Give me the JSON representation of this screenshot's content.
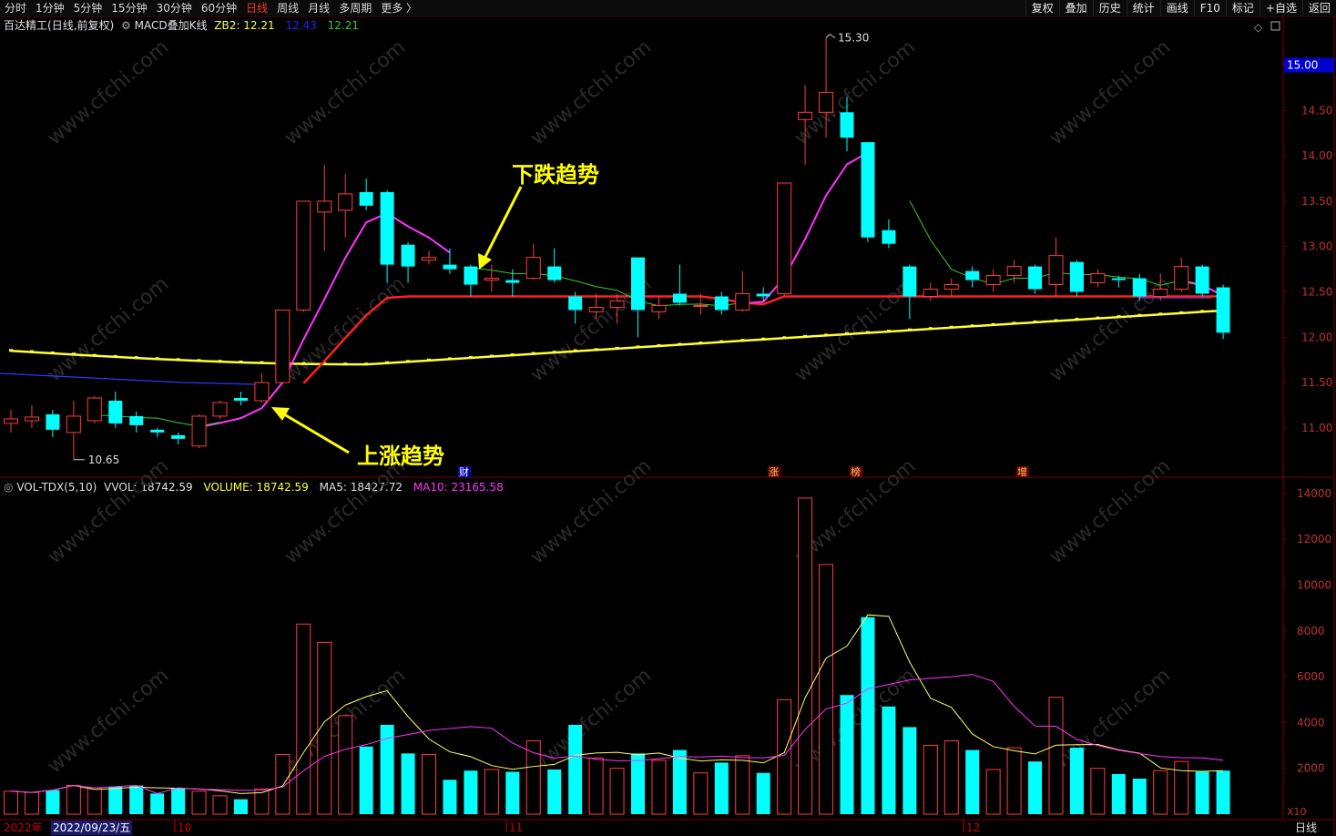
{
  "toolbar": {
    "periods": [
      "分时",
      "1分钟",
      "5分钟",
      "15分钟",
      "30分钟",
      "60分钟",
      "日线",
      "周线",
      "月线",
      "多周期",
      "更多 〉"
    ],
    "active_period": "日线",
    "right_buttons": [
      "复权",
      "叠加",
      "历史",
      "统计",
      "画线",
      "F10",
      "标记",
      "+自选",
      "返回"
    ]
  },
  "main_header": {
    "stock": "百达精工",
    "mode": "(日线,前复权)",
    "indicator": "MACD叠加K线",
    "zb2_label": "ZB2: 12.21",
    "v2": "12.43",
    "v3": "12.21"
  },
  "price_axis": {
    "ticks": [
      "15.00",
      "14.50",
      "14.00",
      "13.50",
      "13.00",
      "12.50",
      "12.00",
      "11.50",
      "11.00"
    ],
    "current": "15.00"
  },
  "annotations": {
    "high": "15.30",
    "low": "10.65",
    "down_trend": "下跌趋势",
    "up_trend": "上涨趋势"
  },
  "event_markers": [
    "财",
    "涨",
    "榜",
    "增"
  ],
  "vol_header": {
    "name": "VOL-TDX(5,10)",
    "vvol": "VVOL: 18742.59",
    "volume": "VOLUME: 18742.59",
    "ma5": "MA5: 18427.72",
    "ma10": "MA10: 23165.58"
  },
  "vol_axis": {
    "ticks": [
      "14000",
      "12000",
      "10000",
      "8000",
      "6000",
      "4000",
      "2000"
    ],
    "unit": "X10"
  },
  "bottom": {
    "year": "2022年",
    "date": "2022/09/23/五",
    "months": [
      "10",
      "11",
      "12"
    ],
    "period": "日线"
  },
  "watermark": "www.cfchi.com",
  "colors": {
    "up": "#ff3c3c",
    "down": "#00ffff",
    "ma_yellow": "#ffff33",
    "ma_red": "#ff2020",
    "ma_magenta": "#ff33ff",
    "ma_green": "#33cc33",
    "ma_blue": "#3333ff"
  },
  "chart_data": {
    "type": "candlestick",
    "candles": [
      {
        "o": 11.05,
        "c": 11.1,
        "h": 11.2,
        "l": 10.95,
        "v": 1000
      },
      {
        "o": 11.08,
        "c": 11.12,
        "h": 11.25,
        "l": 11.0,
        "v": 950
      },
      {
        "o": 11.15,
        "c": 10.98,
        "h": 11.2,
        "l": 10.9,
        "v": 1050
      },
      {
        "o": 10.95,
        "c": 11.13,
        "h": 11.3,
        "l": 10.65,
        "v": 1250
      },
      {
        "o": 11.08,
        "c": 11.33,
        "h": 11.35,
        "l": 11.05,
        "v": 1150
      },
      {
        "o": 11.3,
        "c": 11.05,
        "h": 11.4,
        "l": 11.0,
        "v": 1200
      },
      {
        "o": 11.13,
        "c": 11.03,
        "h": 11.18,
        "l": 10.95,
        "v": 1250
      },
      {
        "o": 10.98,
        "c": 10.95,
        "h": 11.0,
        "l": 10.9,
        "v": 900
      },
      {
        "o": 10.92,
        "c": 10.88,
        "h": 10.95,
        "l": 10.82,
        "v": 1150
      },
      {
        "o": 10.8,
        "c": 11.13,
        "h": 11.15,
        "l": 10.78,
        "v": 1000
      },
      {
        "o": 11.13,
        "c": 11.28,
        "h": 11.3,
        "l": 11.1,
        "v": 800
      },
      {
        "o": 11.33,
        "c": 11.3,
        "h": 11.4,
        "l": 11.25,
        "v": 650
      },
      {
        "o": 11.3,
        "c": 11.5,
        "h": 11.6,
        "l": 11.28,
        "v": 1100
      },
      {
        "o": 11.5,
        "c": 12.3,
        "h": 12.3,
        "l": 11.48,
        "v": 2600
      },
      {
        "o": 12.3,
        "c": 13.5,
        "h": 13.5,
        "l": 12.28,
        "v": 8300
      },
      {
        "o": 13.38,
        "c": 13.5,
        "h": 13.9,
        "l": 12.95,
        "v": 7500
      },
      {
        "o": 13.4,
        "c": 13.58,
        "h": 13.8,
        "l": 13.1,
        "v": 4300
      },
      {
        "o": 13.6,
        "c": 13.45,
        "h": 13.75,
        "l": 13.4,
        "v": 2950
      },
      {
        "o": 13.6,
        "c": 12.8,
        "h": 13.62,
        "l": 12.6,
        "v": 3900
      },
      {
        "o": 13.02,
        "c": 12.78,
        "h": 13.05,
        "l": 12.6,
        "v": 2650
      },
      {
        "o": 12.85,
        "c": 12.88,
        "h": 12.95,
        "l": 12.8,
        "v": 2600
      },
      {
        "o": 12.8,
        "c": 12.75,
        "h": 12.98,
        "l": 12.7,
        "v": 1500
      },
      {
        "o": 12.78,
        "c": 12.58,
        "h": 12.8,
        "l": 12.45,
        "v": 1900
      },
      {
        "o": 12.63,
        "c": 12.65,
        "h": 12.8,
        "l": 12.5,
        "v": 1950
      },
      {
        "o": 12.63,
        "c": 12.6,
        "h": 12.75,
        "l": 12.45,
        "v": 1850
      },
      {
        "o": 12.65,
        "c": 12.88,
        "h": 13.03,
        "l": 12.63,
        "v": 3200
      },
      {
        "o": 12.78,
        "c": 12.63,
        "h": 12.98,
        "l": 12.6,
        "v": 1950
      },
      {
        "o": 12.45,
        "c": 12.3,
        "h": 12.5,
        "l": 12.15,
        "v": 3900
      },
      {
        "o": 12.28,
        "c": 12.33,
        "h": 12.48,
        "l": 12.2,
        "v": 2450
      },
      {
        "o": 12.33,
        "c": 12.4,
        "h": 12.48,
        "l": 12.15,
        "v": 2000
      },
      {
        "o": 12.88,
        "c": 12.3,
        "h": 12.88,
        "l": 12.0,
        "v": 2650
      },
      {
        "o": 12.28,
        "c": 12.35,
        "h": 12.45,
        "l": 12.2,
        "v": 2350
      },
      {
        "o": 12.48,
        "c": 12.38,
        "h": 12.8,
        "l": 12.35,
        "v": 2800
      },
      {
        "o": 12.35,
        "c": 12.35,
        "h": 12.48,
        "l": 12.25,
        "v": 1800
      },
      {
        "o": 12.45,
        "c": 12.3,
        "h": 12.5,
        "l": 12.25,
        "v": 2250
      },
      {
        "o": 12.3,
        "c": 12.48,
        "h": 12.73,
        "l": 12.28,
        "v": 2550
      },
      {
        "o": 12.48,
        "c": 12.45,
        "h": 12.55,
        "l": 12.4,
        "v": 1800
      },
      {
        "o": 12.48,
        "c": 13.7,
        "h": 13.7,
        "l": 12.45,
        "v": 5000
      },
      {
        "o": 14.4,
        "c": 14.48,
        "h": 14.78,
        "l": 13.9,
        "v": 13800
      },
      {
        "o": 14.48,
        "c": 14.7,
        "h": 15.3,
        "l": 14.2,
        "v": 10900
      },
      {
        "o": 14.48,
        "c": 14.2,
        "h": 14.65,
        "l": 14.05,
        "v": 5200
      },
      {
        "o": 14.15,
        "c": 13.1,
        "h": 14.15,
        "l": 13.05,
        "v": 8600
      },
      {
        "o": 13.18,
        "c": 13.03,
        "h": 13.3,
        "l": 12.98,
        "v": 4700
      },
      {
        "o": 12.78,
        "c": 12.45,
        "h": 12.8,
        "l": 12.2,
        "v": 3800
      },
      {
        "o": 12.45,
        "c": 12.53,
        "h": 12.6,
        "l": 12.4,
        "v": 3000
      },
      {
        "o": 12.53,
        "c": 12.58,
        "h": 12.65,
        "l": 12.45,
        "v": 3200
      },
      {
        "o": 12.73,
        "c": 12.63,
        "h": 12.78,
        "l": 12.55,
        "v": 2800
      },
      {
        "o": 12.58,
        "c": 12.68,
        "h": 12.75,
        "l": 12.5,
        "v": 1950
      },
      {
        "o": 12.68,
        "c": 12.78,
        "h": 12.85,
        "l": 12.6,
        "v": 2900
      },
      {
        "o": 12.78,
        "c": 12.53,
        "h": 12.8,
        "l": 12.48,
        "v": 2300
      },
      {
        "o": 12.58,
        "c": 12.9,
        "h": 13.1,
        "l": 12.45,
        "v": 5100
      },
      {
        "o": 12.83,
        "c": 12.5,
        "h": 12.85,
        "l": 12.45,
        "v": 2900
      },
      {
        "o": 12.6,
        "c": 12.7,
        "h": 12.75,
        "l": 12.55,
        "v": 2000
      },
      {
        "o": 12.65,
        "c": 12.63,
        "h": 12.68,
        "l": 12.55,
        "v": 1750
      },
      {
        "o": 12.65,
        "c": 12.45,
        "h": 12.7,
        "l": 12.4,
        "v": 1550
      },
      {
        "o": 12.45,
        "c": 12.53,
        "h": 12.7,
        "l": 12.4,
        "v": 1900
      },
      {
        "o": 12.53,
        "c": 12.78,
        "h": 12.88,
        "l": 12.5,
        "v": 2300
      },
      {
        "o": 12.78,
        "c": 12.48,
        "h": 12.8,
        "l": 12.45,
        "v": 1850
      },
      {
        "o": 12.55,
        "c": 12.05,
        "h": 12.58,
        "l": 11.98,
        "v": 1900
      }
    ]
  }
}
